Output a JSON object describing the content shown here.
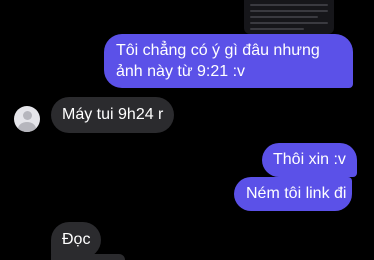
{
  "conversation": {
    "messages": [
      {
        "direction": "outgoing",
        "text": "Tôi chẳng có ý gì đâu nhưng ảnh này từ 9:21 :v"
      },
      {
        "direction": "incoming",
        "text": "Máy tui 9h24 r"
      },
      {
        "direction": "outgoing",
        "text": "Thôi xin :v"
      },
      {
        "direction": "outgoing",
        "text": "Ném tôi link đi"
      },
      {
        "direction": "incoming",
        "text": "Đọc"
      }
    ]
  },
  "colors": {
    "background": "#000000",
    "outgoing_bubble": "#5b51e8",
    "incoming_bubble": "#2b2b2e",
    "text": "#ffffff"
  },
  "icons": {
    "avatar": "default-user-avatar-icon"
  }
}
